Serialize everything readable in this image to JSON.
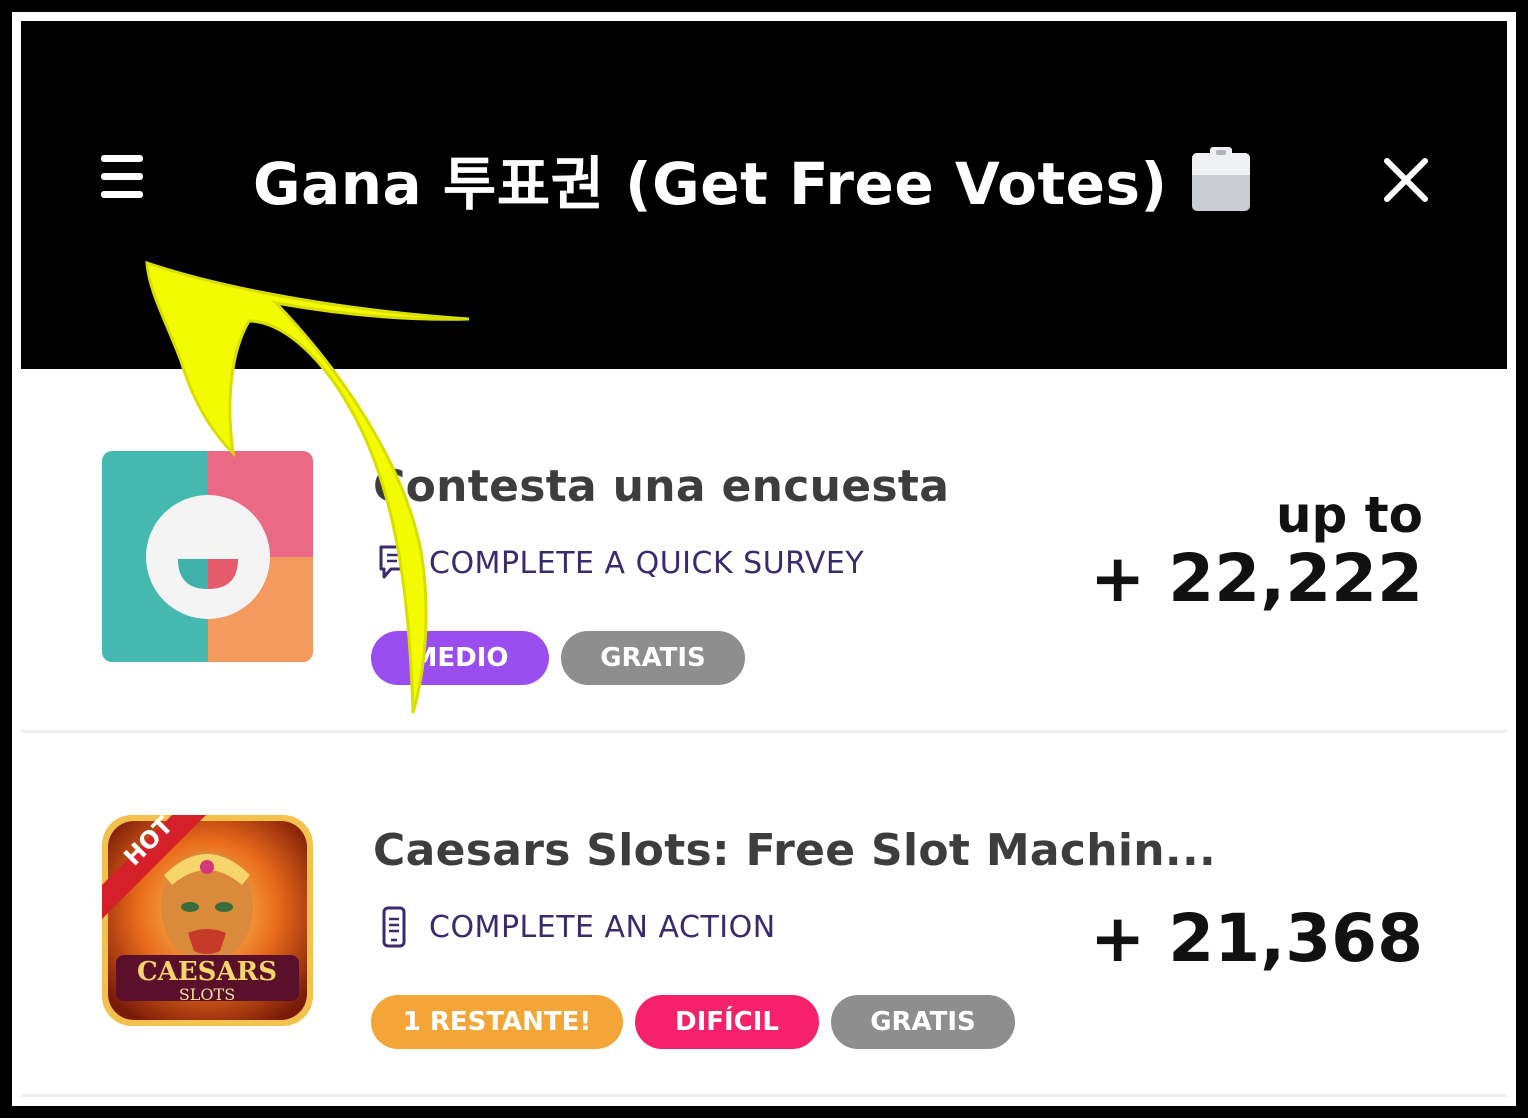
{
  "header": {
    "menu_icon": "hamburger-menu-icon",
    "title": "Gana 투표권 (Get Free Votes)",
    "title_icon": "clipboard-icon",
    "close_icon": "close-icon"
  },
  "offers": [
    {
      "icon": "survey-app-icon",
      "title": "Contesta una encuesta",
      "subtitle_icon": "chat-bubble-icon",
      "subtitle": "COMPLETE A QUICK SURVEY",
      "tags": [
        {
          "label": "MEDIO",
          "color": "#9a4ef0"
        },
        {
          "label": "GRATIS",
          "color": "#8e8e8e"
        }
      ],
      "reward_prefix": "up to",
      "reward": "+ 22,222"
    },
    {
      "icon": "caesars-slots-app-icon",
      "icon_badge": "HOT",
      "icon_text_1": "CAESARS",
      "icon_text_2": "SLOTS",
      "title": "Caesars Slots: Free Slot Machin...",
      "subtitle_icon": "phone-icon",
      "subtitle": "COMPLETE AN ACTION",
      "tags": [
        {
          "label": "1 RESTANTE!",
          "color": "#f3a637"
        },
        {
          "label": "DIFÍCIL",
          "color": "#f5216b"
        },
        {
          "label": "GRATIS",
          "color": "#8e8e8e"
        }
      ],
      "reward": "+ 21,368"
    }
  ],
  "colors": {
    "header_bg": "#000000",
    "annotation_arrow": "#f4fb00"
  }
}
